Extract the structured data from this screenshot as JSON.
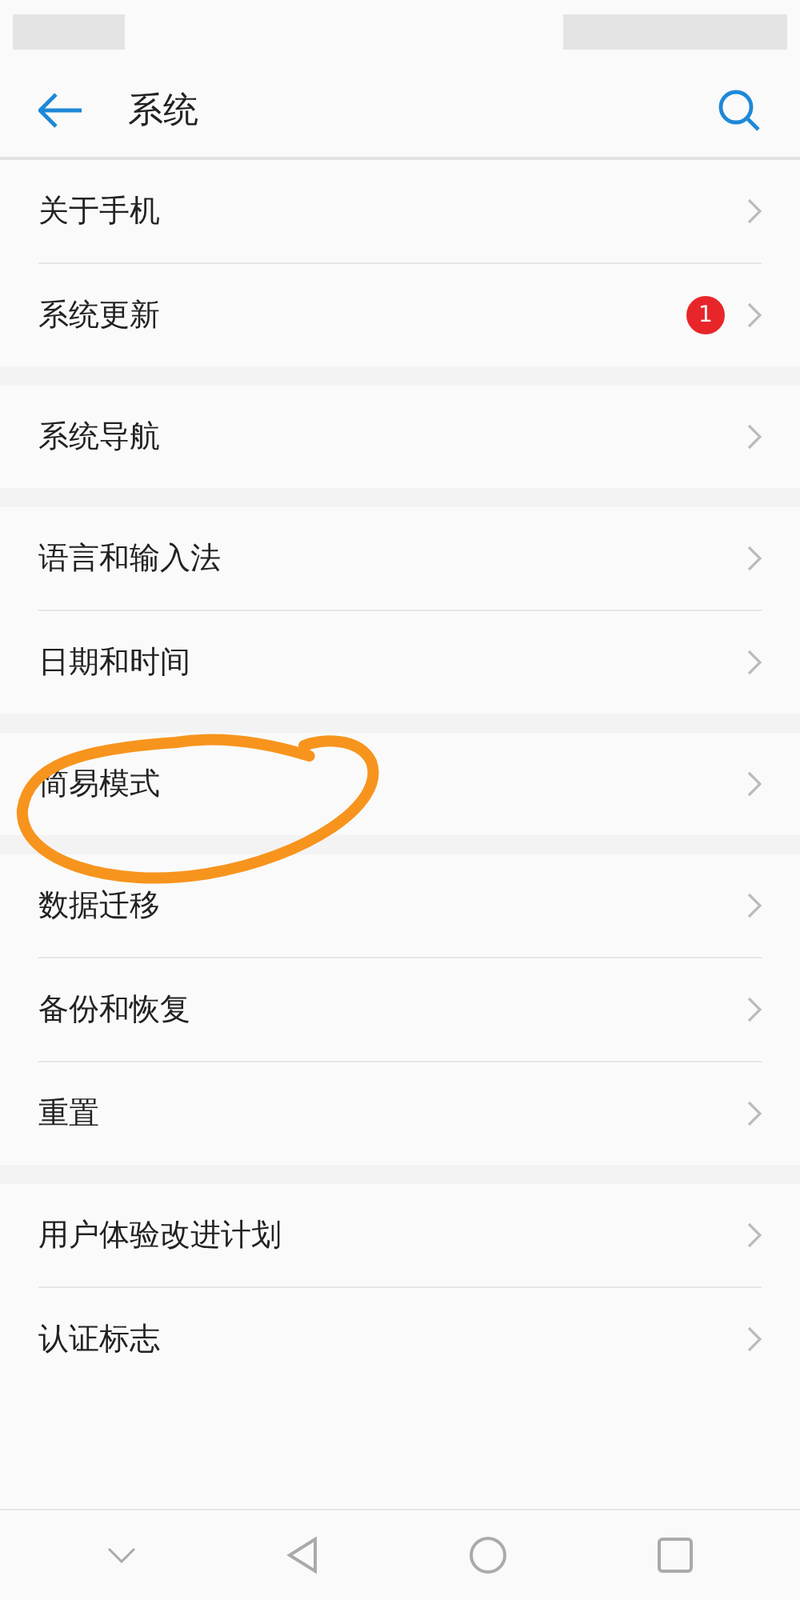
{
  "header": {
    "title": "系统"
  },
  "groups": [
    {
      "items": [
        {
          "label": "关于手机",
          "annotated": false
        },
        {
          "label": "系统更新",
          "badge": "1",
          "annotated": false
        }
      ]
    },
    {
      "items": [
        {
          "label": "系统导航",
          "annotated": false
        }
      ]
    },
    {
      "items": [
        {
          "label": "语言和输入法",
          "annotated": false
        },
        {
          "label": "日期和时间",
          "annotated": false
        }
      ]
    },
    {
      "items": [
        {
          "label": "简易模式",
          "annotated": true
        }
      ]
    },
    {
      "items": [
        {
          "label": "数据迁移",
          "annotated": false
        },
        {
          "label": "备份和恢复",
          "annotated": false
        },
        {
          "label": "重置",
          "annotated": false
        }
      ]
    },
    {
      "items": [
        {
          "label": "用户体验改进计划",
          "annotated": false
        },
        {
          "label": "认证标志",
          "annotated": false
        }
      ]
    }
  ]
}
